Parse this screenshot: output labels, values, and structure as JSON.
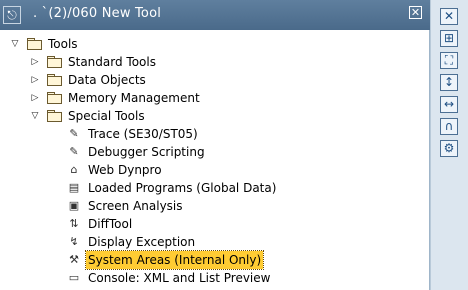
{
  "window": {
    "title": ". `(2)/060 New Tool",
    "title_icon": "window-icon",
    "close_icon": "close-icon"
  },
  "tree": [
    {
      "id": "tools",
      "label": "Tools",
      "level": 0,
      "expander": "expanded",
      "icon": "folder-open-icon"
    },
    {
      "id": "standard-tools",
      "label": "Standard Tools",
      "level": 1,
      "expander": "collapsed",
      "icon": "folder-icon"
    },
    {
      "id": "data-objects",
      "label": "Data Objects",
      "level": 1,
      "expander": "collapsed",
      "icon": "folder-icon"
    },
    {
      "id": "memory-management",
      "label": "Memory Management",
      "level": 1,
      "expander": "collapsed",
      "icon": "folder-icon"
    },
    {
      "id": "special-tools",
      "label": "Special Tools",
      "level": 1,
      "expander": "expanded",
      "icon": "folder-open-icon"
    },
    {
      "id": "trace",
      "label": "Trace (SE30/ST05)",
      "level": 2,
      "icon": "trace-icon"
    },
    {
      "id": "debugger-scripting",
      "label": "Debugger Scripting",
      "level": 2,
      "icon": "script-icon"
    },
    {
      "id": "web-dynpro",
      "label": "Web Dynpro",
      "level": 2,
      "icon": "web-dynpro-icon"
    },
    {
      "id": "loaded-programs",
      "label": "Loaded Programs (Global Data)",
      "level": 2,
      "icon": "loaded-programs-icon"
    },
    {
      "id": "screen-analysis",
      "label": "Screen Analysis",
      "level": 2,
      "icon": "screen-icon"
    },
    {
      "id": "difftool",
      "label": "DiffTool",
      "level": 2,
      "icon": "diff-icon"
    },
    {
      "id": "display-exception",
      "label": "Display Exception",
      "level": 2,
      "icon": "exception-icon"
    },
    {
      "id": "system-areas",
      "label": "System Areas (Internal Only)",
      "level": 2,
      "icon": "system-areas-icon",
      "selected": true
    },
    {
      "id": "console",
      "label": "Console: XML and List Preview",
      "level": 2,
      "icon": "console-icon"
    }
  ],
  "sidebar": [
    {
      "name": "close-icon",
      "glyph": "✕"
    },
    {
      "name": "maximize-icon",
      "glyph": "⊞"
    },
    {
      "name": "fullscreen-icon",
      "glyph": "⛶"
    },
    {
      "name": "expand-vertical-icon",
      "glyph": "↕"
    },
    {
      "name": "expand-horizontal-icon",
      "glyph": "↔"
    },
    {
      "name": "headphones-icon",
      "glyph": "∩"
    },
    {
      "name": "settings-icon",
      "glyph": "⚙"
    }
  ],
  "colors": {
    "title_bg": "#4a6a8a",
    "selection": "#ffcc33",
    "sidebar_bg": "#dce6ef"
  }
}
